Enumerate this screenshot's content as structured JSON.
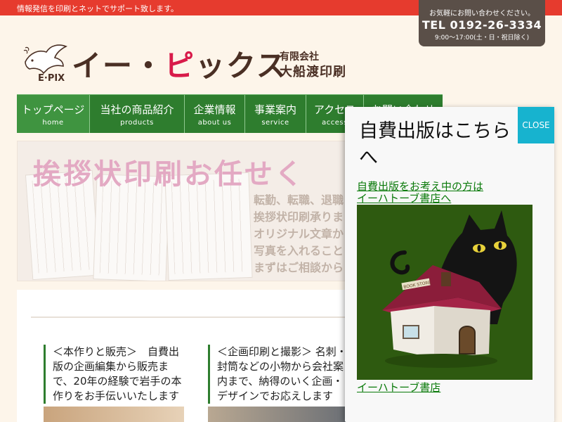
{
  "topbar": {
    "tagline": "情報発信を印刷とネットでサポート致します。"
  },
  "contact": {
    "lead": "お気軽にお問い合わせください。",
    "tel": "TEL 0192-26-3334",
    "hours": "9:00～17:00(土・日・祝日除く)"
  },
  "logo": {
    "mark_text": "E·PIX",
    "brand_a": "イー・",
    "brand_b": "ピ",
    "brand_c": "ックス",
    "company_type": "有限会社",
    "company_name": "大船渡印刷"
  },
  "nav": [
    {
      "ja": "トップページ",
      "en": "home"
    },
    {
      "ja": "当社の商品紹介",
      "en": "products"
    },
    {
      "ja": "企業情報",
      "en": "about us"
    },
    {
      "ja": "事業案内",
      "en": "service"
    },
    {
      "ja": "アクセス",
      "en": "access"
    },
    {
      "ja": "お問い合わせ",
      "en": ""
    }
  ],
  "hero": {
    "headline": "挨拶状印刷お任せく",
    "lines": [
      "転勤、転職、退職",
      "挨拶状印刷承りま",
      "オリジナル文章か",
      "写真を入れること",
      "まずはご相談から"
    ]
  },
  "columns": {
    "left": "＜本作りと販売＞　自費出版の企画編集から販売まで、20年の経験で岩手の本作りをお手伝いいたします",
    "right": "＜企画印刷と撮影＞ 名刺・封筒などの小物から会社案内まで、納得のいく企画・デザインでお応えします"
  },
  "popup": {
    "title": "自費出版はこちらへ",
    "close": "CLOSE",
    "link_line1": "自費出版をお考え中の方は",
    "link_line2": "イーハトーブ書店へ",
    "image_caption": "イーハトーブ書店",
    "sign_text": "BOOK STORE"
  },
  "colors": {
    "red_bar": "#e63b2e",
    "nav_green": "#2e7d2e",
    "close_cyan": "#17b3cf",
    "image_bg": "#2e5a10"
  }
}
